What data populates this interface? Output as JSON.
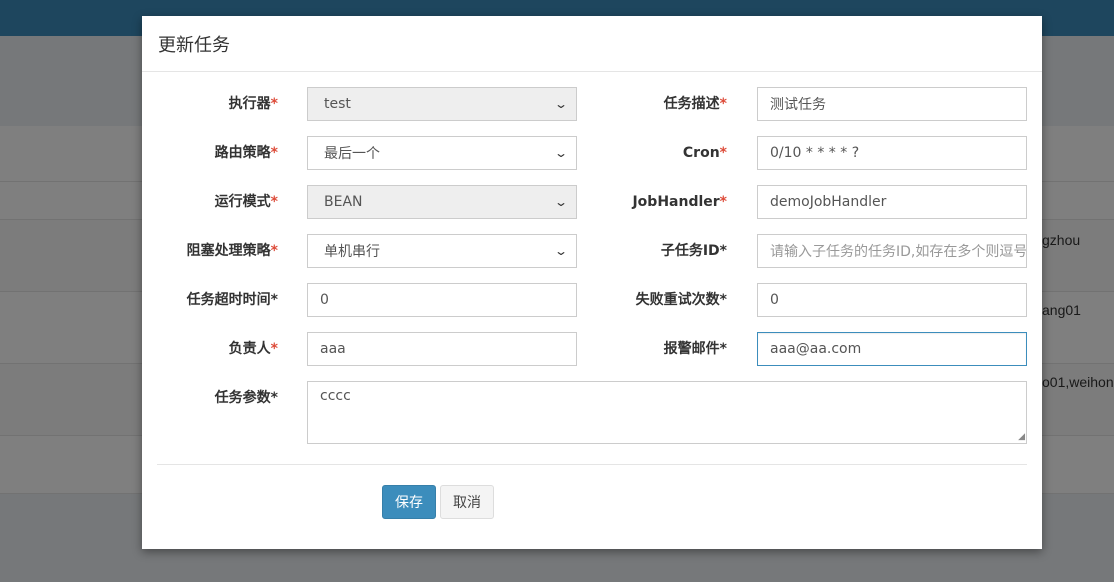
{
  "background": {
    "row_cells": [
      "gzhou",
      "ang01",
      "o01,weihon"
    ],
    "colors": {
      "topbar": "#3c8dbc",
      "page": "#ecf0f5"
    }
  },
  "modal": {
    "title": "更新任务",
    "required_mark": "*",
    "fields": {
      "executor": {
        "label": "执行器",
        "value": "test"
      },
      "description": {
        "label": "任务描述",
        "value": "测试任务"
      },
      "route_strategy": {
        "label": "路由策略",
        "value": "最后一个"
      },
      "cron": {
        "label": "Cron",
        "value": "0/10 * * * * ?"
      },
      "run_mode": {
        "label": "运行模式",
        "value": "BEAN"
      },
      "job_handler": {
        "label": "JobHandler",
        "value": "demoJobHandler"
      },
      "block_strategy": {
        "label": "阻塞处理策略",
        "value": "单机串行"
      },
      "child_job_id": {
        "label": "子任务ID*",
        "placeholder": "请输入子任务的任务ID,如存在多个则逗号分隔"
      },
      "timeout": {
        "label": "任务超时时间*",
        "value": "0"
      },
      "fail_retry": {
        "label": "失败重试次数*",
        "value": "0"
      },
      "owner": {
        "label": "负责人",
        "value": "aaa"
      },
      "alarm_email": {
        "label": "报警邮件*",
        "value": "aaa@aa.com"
      },
      "params": {
        "label": "任务参数*",
        "value": "cccc"
      }
    },
    "buttons": {
      "save": "保存",
      "cancel": "取消"
    },
    "colors": {
      "primary": "#3c8dbc",
      "required": "#dd4b39"
    }
  }
}
